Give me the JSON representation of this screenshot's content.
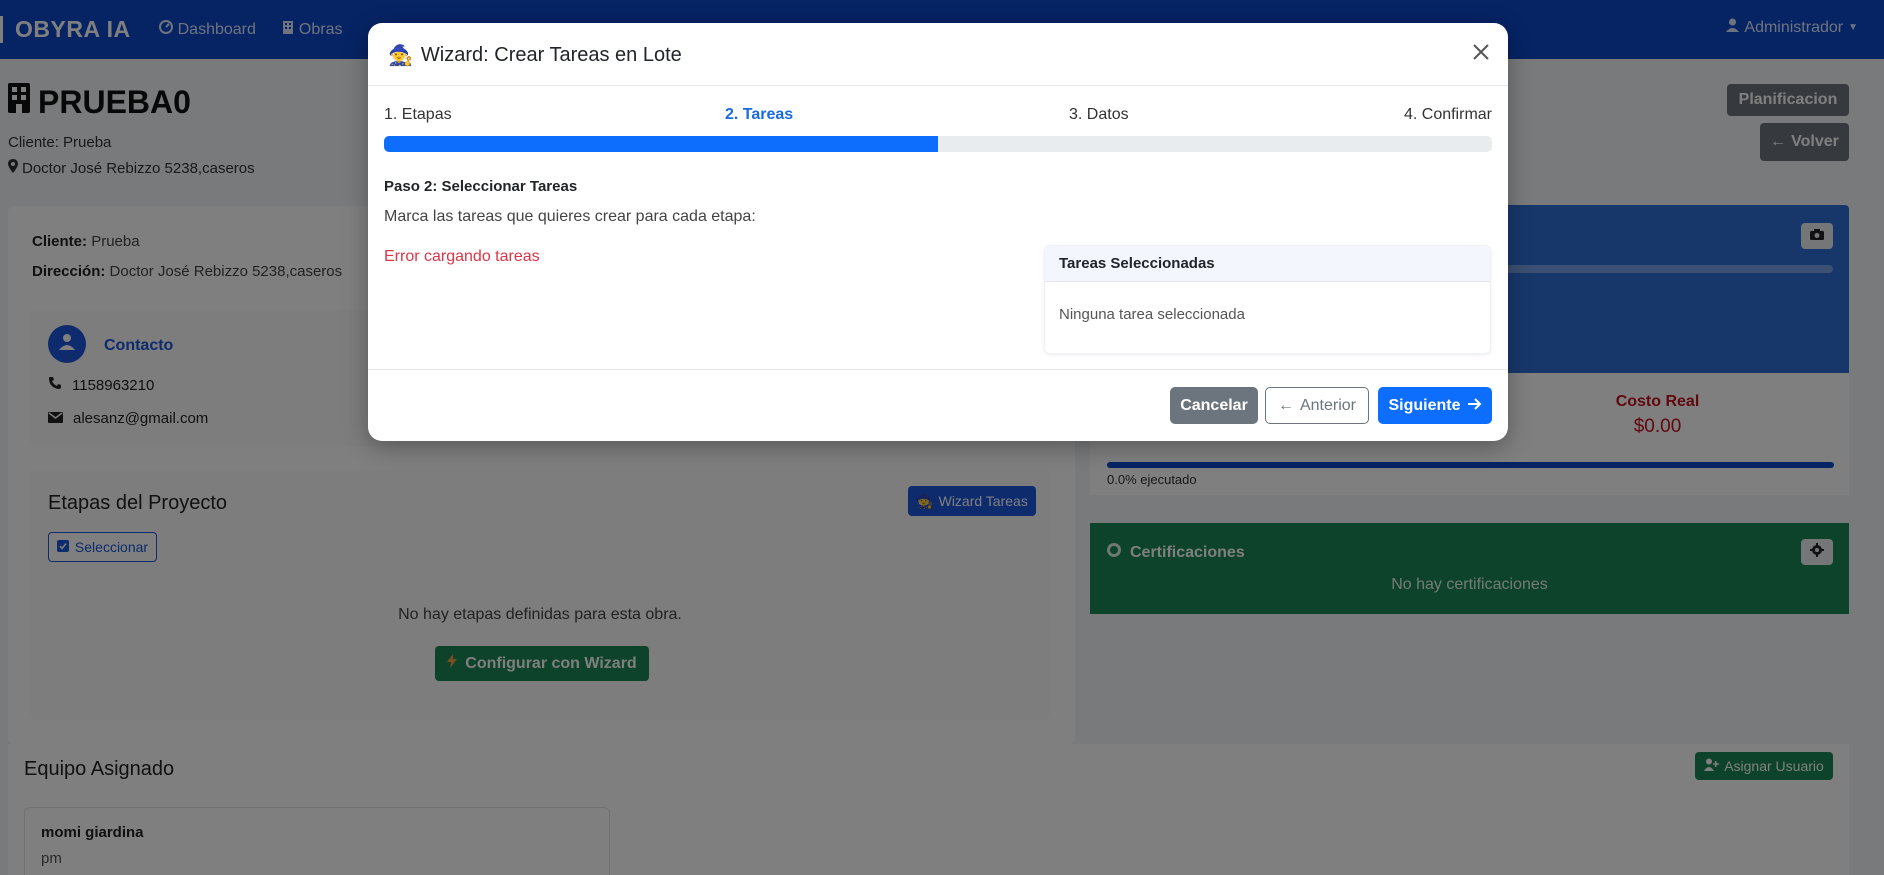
{
  "navbar": {
    "brand": "OBYRA IA",
    "items": [
      {
        "label": "Dashboard",
        "icon": "dashboard-icon"
      },
      {
        "label": "Obras",
        "icon": "building-icon"
      }
    ],
    "user": "Administrador"
  },
  "page": {
    "title": "PRUEBA0",
    "client_line": "Cliente: Prueba",
    "address_line": "Doctor José Rebizzo 5238,caseros",
    "btn_planificacion": "Planificacion",
    "btn_volver": "Volver"
  },
  "info": {
    "cliente_label": "Cliente:",
    "cliente_value": "Prueba",
    "direccion_label": "Dirección:",
    "direccion_value": "Doctor José Rebizzo 5238,caseros"
  },
  "contact": {
    "title": "Contacto",
    "phone": "1158963210",
    "email": "alesanz@gmail.com"
  },
  "etapas": {
    "title": "Etapas del Proyecto",
    "btn_wizard": "Wizard Tareas",
    "btn_seleccionar": "Seleccionar",
    "empty": "No hay etapas definidas para esta obra.",
    "btn_configurar": "Configurar con Wizard"
  },
  "costs": {
    "costo_real_label": "Costo Real",
    "costo_real_value": "$0.00",
    "executed_percent": 0.0,
    "executed_text": "0.0% ejecutado"
  },
  "certificaciones": {
    "title": "Certificaciones",
    "empty": "No hay certificaciones"
  },
  "equipo": {
    "title": "Equipo Asignado",
    "btn_asignar": "Asignar Usuario",
    "members": [
      {
        "name": "momi giardina",
        "role": "pm"
      }
    ]
  },
  "modal": {
    "title": "Wizard: Crear Tareas en Lote",
    "steps": [
      "1. Etapas",
      "2. Tareas",
      "3. Datos",
      "4. Confirmar"
    ],
    "active_step": 2,
    "progress_percent": 50,
    "step_heading": "Paso 2: Seleccionar Tareas",
    "step_desc": "Marca las tareas que quieres crear para cada etapa:",
    "error": "Error cargando tareas",
    "selected_title": "Tareas Seleccionadas",
    "selected_empty": "Ninguna tarea seleccionada",
    "btn_cancelar": "Cancelar",
    "btn_anterior": "Anterior",
    "btn_siguiente": "Siguiente"
  },
  "colors": {
    "navbar": "#0d47c9",
    "primary": "#0d6efd",
    "success": "#198754",
    "danger": "#dc3545",
    "secondary": "#6c757d"
  }
}
